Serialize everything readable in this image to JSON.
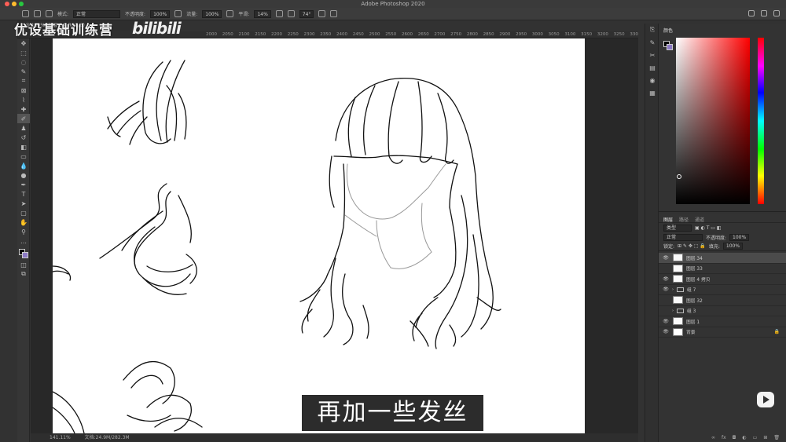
{
  "app": {
    "title": "Adobe Photoshop 2020"
  },
  "watermark": {
    "text": "优设基础训练营",
    "logo": "bilibili"
  },
  "options_bar": {
    "mode_label": "模式:",
    "mode_value": "正常",
    "opacity_label": "不透明度:",
    "opacity_value": "100%",
    "flow_label": "流量:",
    "flow_value": "100%",
    "smooth_label": "平滑:",
    "smooth_value": "14%",
    "angle_value": "74°"
  },
  "doc_tab": {
    "label": "…@ 100% (图层 34, RGB/8)"
  },
  "ruler": {
    "labels": "2000 2050 2100 2150 2200 2250 2300 2350 2400 2450 2500 2550 2600 2650 2700 2750 2800 2850 2900 2950 3000 3050 3100 3150 3200 3250 3300 3350 3400 3450 3500 3550 3600 3650 3700"
  },
  "status": {
    "zoom": "141.11%",
    "doc": "文档:24.9M/282.3M"
  },
  "color_panel": {
    "title": "颜色",
    "fg": "#000000",
    "bg": "#8b79c4"
  },
  "layers_panel": {
    "tabs": [
      "图层",
      "路径",
      "通道"
    ],
    "filter_value": "类型",
    "blend_mode": "正常",
    "opacity_label": "不透明度:",
    "opacity_value": "100%",
    "lock_label": "锁定:",
    "fill_label": "填充:",
    "fill_value": "100%",
    "layers": [
      {
        "name": "图层 34",
        "visible": true,
        "selected": true,
        "type": "layer"
      },
      {
        "name": "图层 33",
        "visible": false,
        "selected": false,
        "type": "layer"
      },
      {
        "name": "图层 4 拷贝",
        "visible": true,
        "selected": false,
        "type": "layer"
      },
      {
        "name": "组 7",
        "visible": true,
        "selected": false,
        "type": "group"
      },
      {
        "name": "图层 32",
        "visible": false,
        "selected": false,
        "type": "layer"
      },
      {
        "name": "组 3",
        "visible": false,
        "selected": false,
        "type": "group"
      },
      {
        "name": "图层 1",
        "visible": true,
        "selected": false,
        "type": "layer"
      },
      {
        "name": "背景",
        "visible": true,
        "selected": false,
        "type": "background",
        "locked": true
      }
    ]
  },
  "subtitle": {
    "text": "再加一些发丝"
  }
}
